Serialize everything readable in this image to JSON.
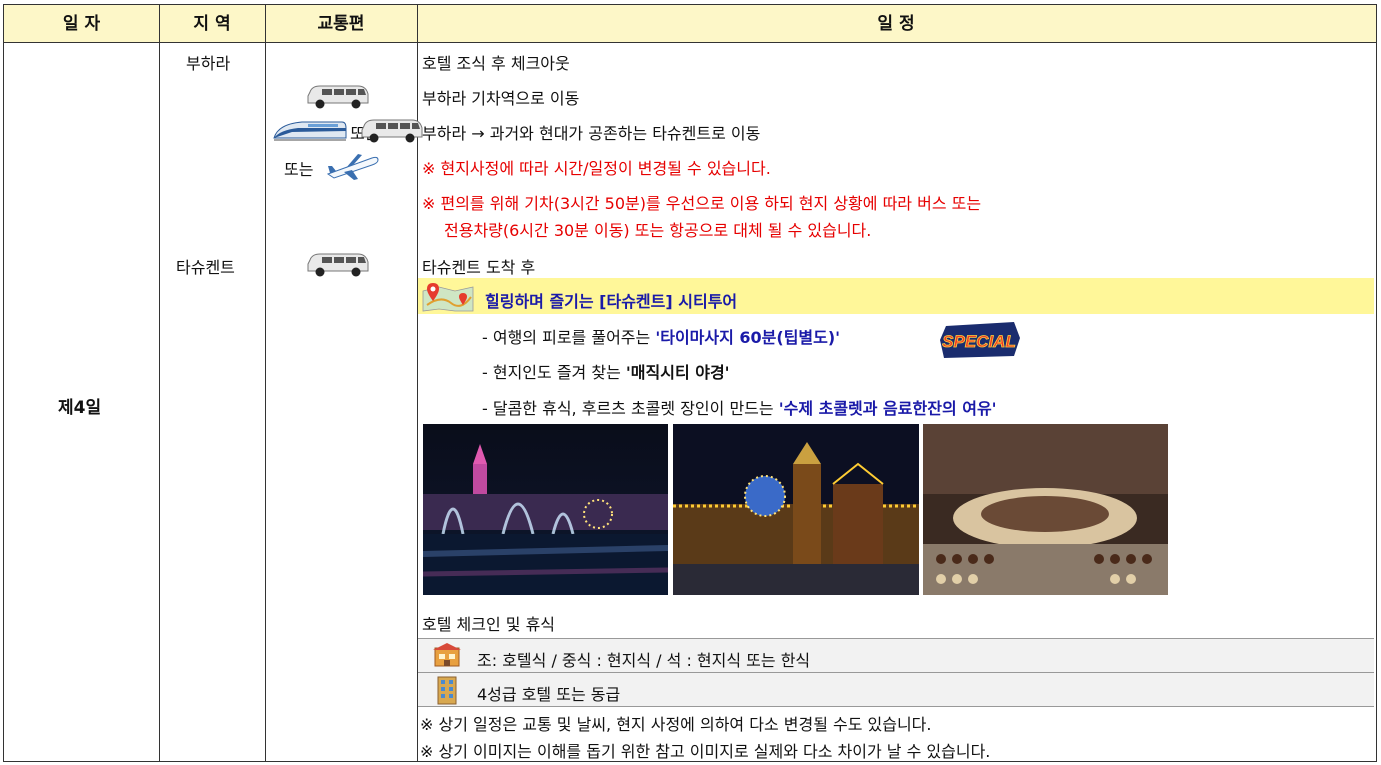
{
  "header": {
    "day": "일 자",
    "region": "지 역",
    "transport": "교통편",
    "schedule": "일 정"
  },
  "day": "제4일",
  "regions": {
    "r1": "부하라",
    "r2": "타슈켄트"
  },
  "transport": {
    "or1": "또는",
    "or2": "또는"
  },
  "schedule": {
    "l1": "호텔 조식 후 체크아웃",
    "l2": "부하라 기차역으로 이동",
    "l3": "부하라 → 과거와 현대가 공존하는 타슈켄트로 이동",
    "l4": "※ 현지사정에 따라 시간/일정이 변경될 수 있습니다.",
    "l5a": "※ 편의를 위해 기차(3시간 50분)를 우선으로 이용 하되 현지 상황에 따라 버스 또는",
    "l5b": "전용차량(6시간 30분 이동) 또는 항공으로 대체 될 수 있습니다.",
    "l6": "타슈켄트 도착 후",
    "highlight": "힐링하며 즐기는 [타슈켄트] 시티투어",
    "b1_pre": "- 여행의 피로를 풀어주는 ",
    "b1_em": "'타이마사지 60분(팁별도)'",
    "special": "SPECIAL",
    "b2_pre": "- 현지인도 즐겨 찾는 ",
    "b2_em": "'매직시티 야경'",
    "b3_pre": "- 달콤한 휴식, 후르츠 초콜렛 장인이 만드는 ",
    "b3_em": "'수제 초콜렛과 음료한잔의 여유'",
    "l7": "호텔 체크인 및 휴식",
    "meal": "조: 호텔식 / 중식 : 현지식 / 석 : 현지식 또는 한식",
    "hotel": "4성급 호텔 또는 동급",
    "note1": "※ 상기 일정은 교통 및 날씨, 현지 사정에 의하여 다소 변경될 수도 있습니다.",
    "note2": "※ 상기 이미지는 이해를 돕기 위한 참고 이미지로 실제와 다소 차이가 날 수 있습니다."
  },
  "icons": [
    "van-icon",
    "train-icon",
    "airplane-icon",
    "map-pin-icon",
    "restaurant-icon",
    "hotel-building-icon"
  ]
}
